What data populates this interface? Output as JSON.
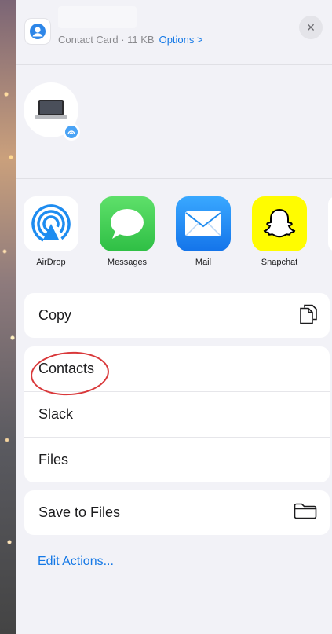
{
  "header": {
    "subtitle": "Contact Card · 11 KB",
    "options_label": "Options >",
    "close_label": "×"
  },
  "apps": [
    {
      "label": "AirDrop",
      "icon": "airdrop-icon",
      "bg": "#ffffff"
    },
    {
      "label": "Messages",
      "icon": "messages-icon",
      "bg": "#34c759"
    },
    {
      "label": "Mail",
      "icon": "mail-icon",
      "bg": "#1e8cf0"
    },
    {
      "label": "Snapchat",
      "icon": "snapchat-icon",
      "bg": "#fffc00"
    }
  ],
  "actions_group1": [
    {
      "label": "Copy",
      "icon": "copy-icon"
    }
  ],
  "actions_group2": [
    {
      "label": "Contacts"
    },
    {
      "label": "Slack"
    },
    {
      "label": "Files"
    }
  ],
  "actions_group3": [
    {
      "label": "Save to Files",
      "icon": "folder-icon"
    }
  ],
  "edit_actions": "Edit Actions...",
  "colors": {
    "accent": "#1478e6",
    "annotation": "#d9383a"
  }
}
